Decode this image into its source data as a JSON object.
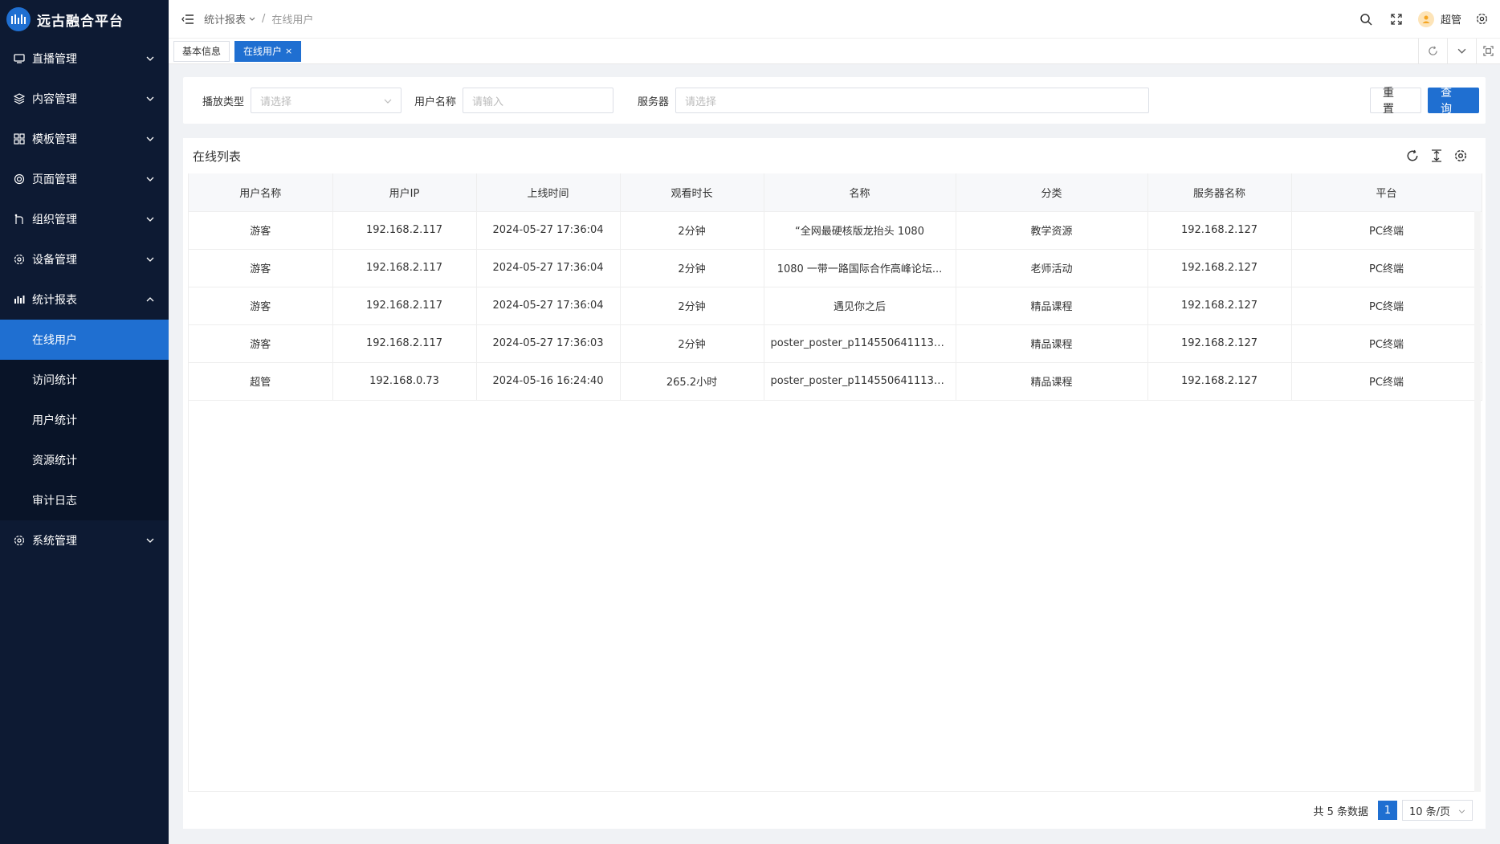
{
  "app": {
    "title": "远古融合平台"
  },
  "sidebar": {
    "items": [
      {
        "label": "直播管理",
        "icon": "monitor-icon"
      },
      {
        "label": "内容管理",
        "icon": "layers-icon"
      },
      {
        "label": "模板管理",
        "icon": "grid-icon"
      },
      {
        "label": "页面管理",
        "icon": "target-icon"
      },
      {
        "label": "组织管理",
        "icon": "org-icon"
      },
      {
        "label": "设备管理",
        "icon": "gear-icon"
      },
      {
        "label": "统计报表",
        "icon": "bar-chart-icon",
        "expanded": true
      }
    ],
    "sub_items": [
      {
        "label": "在线用户",
        "active": true
      },
      {
        "label": "访问统计"
      },
      {
        "label": "用户统计"
      },
      {
        "label": "资源统计"
      },
      {
        "label": "审计日志"
      }
    ],
    "system": {
      "label": "系统管理",
      "icon": "gear-icon"
    }
  },
  "header": {
    "breadcrumb": {
      "parent": "统计报表",
      "separator": "/",
      "current": "在线用户"
    },
    "username": "超管"
  },
  "tabs": [
    {
      "label": "基本信息"
    },
    {
      "label": "在线用户",
      "close": "×",
      "active": true
    }
  ],
  "search": {
    "play_type_label": "播放类型",
    "play_type_placeholder": "请选择",
    "username_label": "用户名称",
    "username_placeholder": "请输入",
    "server_label": "服务器",
    "server_placeholder": "请选择",
    "reset_label": "重 置",
    "query_label": "查 询"
  },
  "table": {
    "title": "在线列表",
    "columns": [
      "用户名称",
      "用户IP",
      "上线时间",
      "观看时长",
      "名称",
      "分类",
      "服务器名称",
      "平台"
    ],
    "rows": [
      [
        "游客",
        "192.168.2.117",
        "2024-05-27 17:36:04",
        "2分钟",
        "“全网最硬核版龙抬头 1080",
        "教学资源",
        "192.168.2.127",
        "PC终端"
      ],
      [
        "游客",
        "192.168.2.117",
        "2024-05-27 17:36:04",
        "2分钟",
        "1080 一带一路国际合作高峰论坛...",
        "老师活动",
        "192.168.2.127",
        "PC终端"
      ],
      [
        "游客",
        "192.168.2.117",
        "2024-05-27 17:36:04",
        "2分钟",
        "遇见你之后",
        "精品课程",
        "192.168.2.127",
        "PC终端"
      ],
      [
        "游客",
        "192.168.2.117",
        "2024-05-27 17:36:03",
        "2分钟",
        "poster_poster_p11455064111320...",
        "精品课程",
        "192.168.2.127",
        "PC终端"
      ],
      [
        "超管",
        "192.168.0.73",
        "2024-05-16 16:24:40",
        "265.2小时",
        "poster_poster_p11455064111320...",
        "精品课程",
        "192.168.2.127",
        "PC终端"
      ]
    ]
  },
  "pager": {
    "total": "共 5 条数据",
    "page": "1",
    "page_size": "10 条/页"
  },
  "colors": {
    "sidebar_bg": "#0d1a33",
    "accent": "#1f6fd1"
  }
}
